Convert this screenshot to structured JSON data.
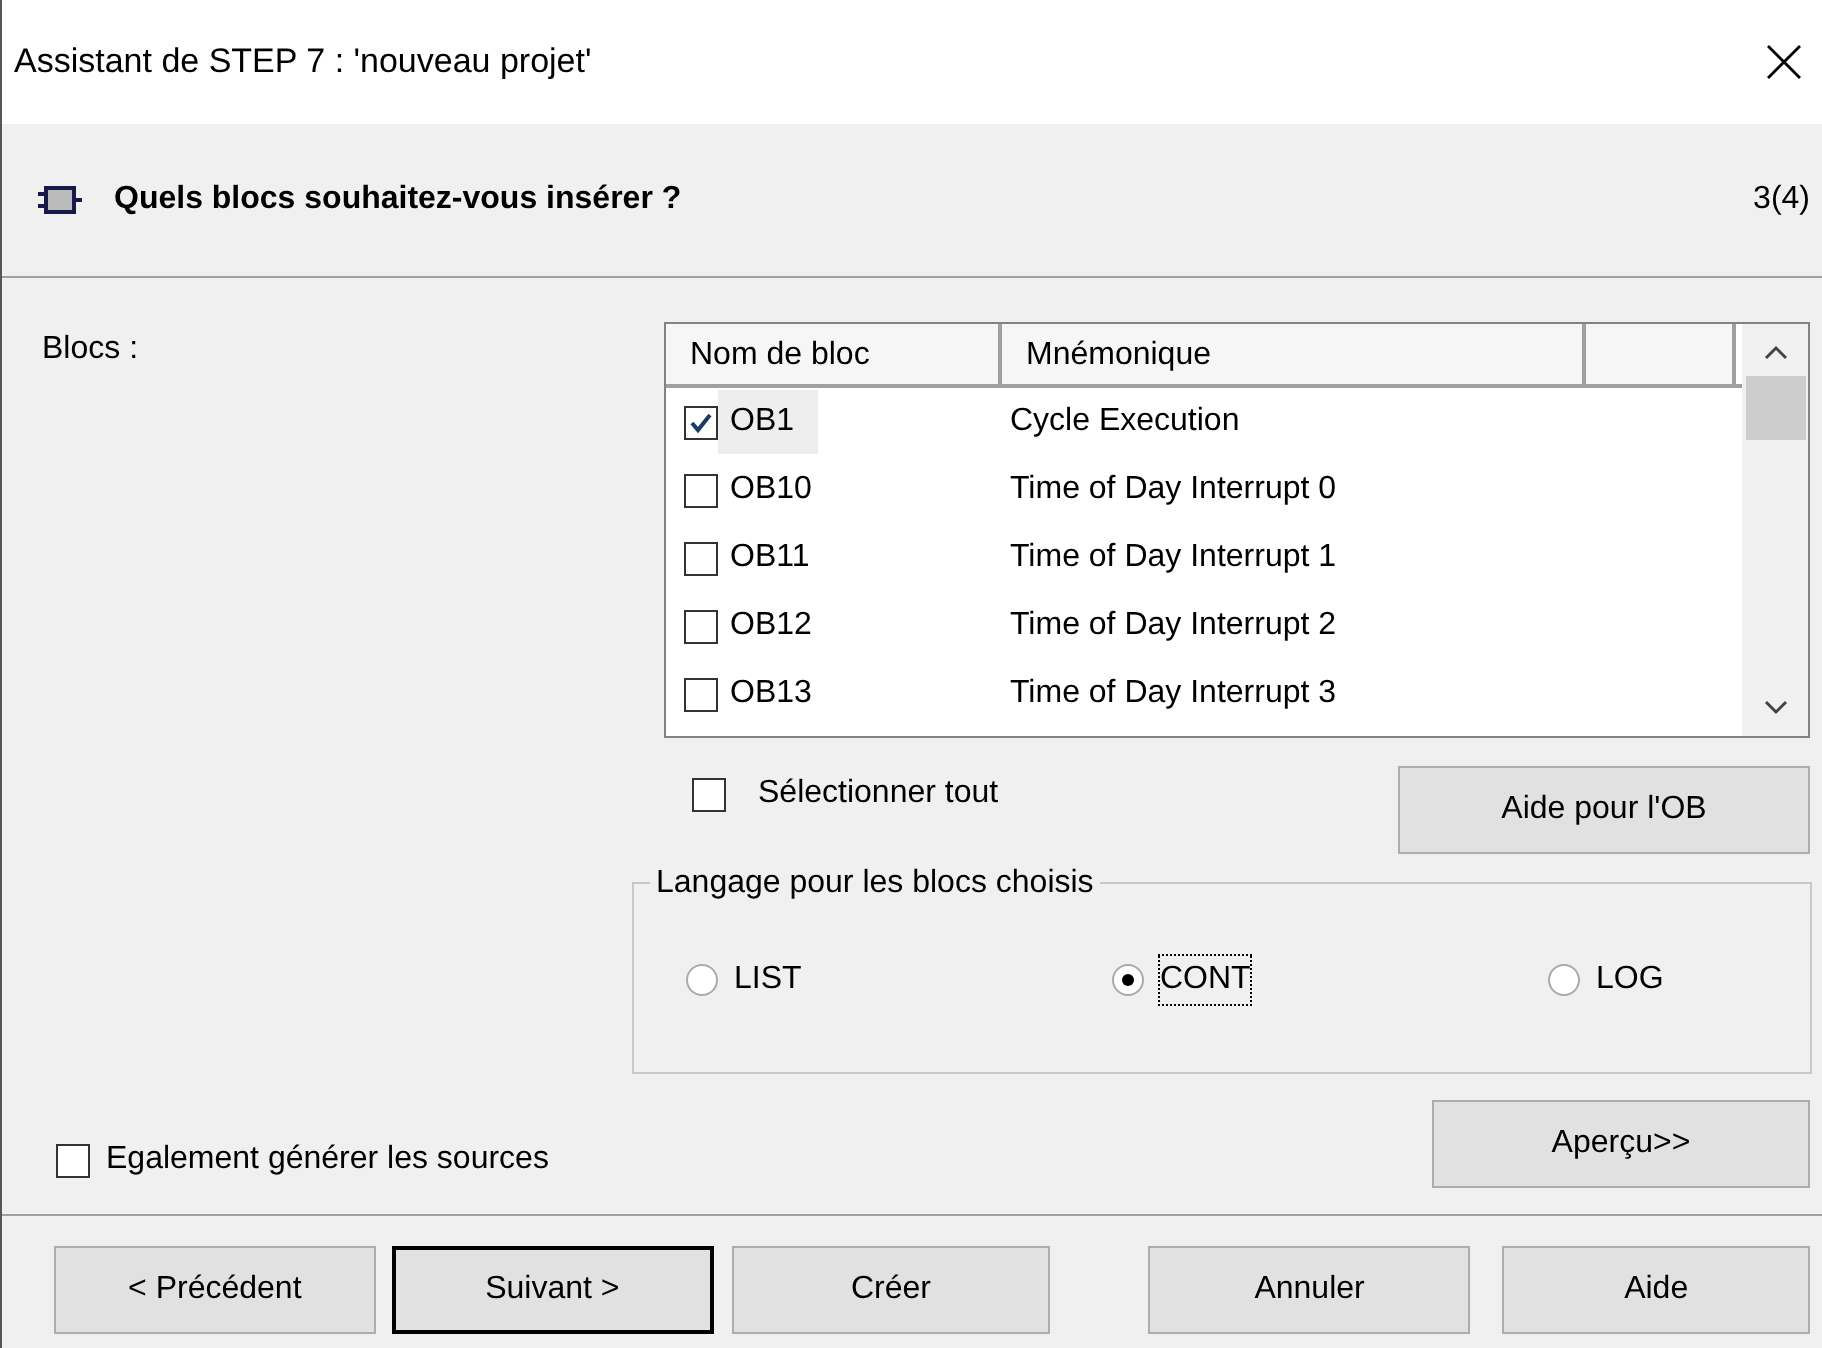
{
  "window": {
    "title": "Assistant de STEP 7 : 'nouveau projet'"
  },
  "header": {
    "title": "Quels blocs souhaitez-vous insérer ?",
    "step": "3(4)"
  },
  "blocks_label": "Blocs :",
  "blocks_table": {
    "columns": [
      "Nom de bloc",
      "Mnémonique"
    ],
    "rows": [
      {
        "name": "OB1",
        "mnemonic": "Cycle Execution",
        "checked": true,
        "selected": true
      },
      {
        "name": "OB10",
        "mnemonic": "Time of Day Interrupt 0",
        "checked": false,
        "selected": false
      },
      {
        "name": "OB11",
        "mnemonic": "Time of Day Interrupt 1",
        "checked": false,
        "selected": false
      },
      {
        "name": "OB12",
        "mnemonic": "Time of Day Interrupt 2",
        "checked": false,
        "selected": false
      },
      {
        "name": "OB13",
        "mnemonic": "Time of Day Interrupt 3",
        "checked": false,
        "selected": false
      }
    ]
  },
  "select_all": {
    "label": "Sélectionner tout",
    "checked": false
  },
  "ob_help_button": "Aide pour l'OB",
  "language_group": {
    "title": "Langage pour les blocs choisis",
    "options": [
      {
        "label": "LIST",
        "selected": false
      },
      {
        "label": "CONT",
        "selected": true
      },
      {
        "label": "LOG",
        "selected": false
      }
    ]
  },
  "generate_sources": {
    "label": "Egalement générer les sources",
    "checked": false
  },
  "preview_button": "Aperçu>>",
  "buttons": [
    {
      "label": "< Précédent",
      "default": false
    },
    {
      "label": "Suivant >",
      "default": true
    },
    {
      "label": "Créer",
      "default": false
    },
    {
      "label": "Annuler",
      "default": false
    },
    {
      "label": "Aide",
      "default": false
    }
  ]
}
